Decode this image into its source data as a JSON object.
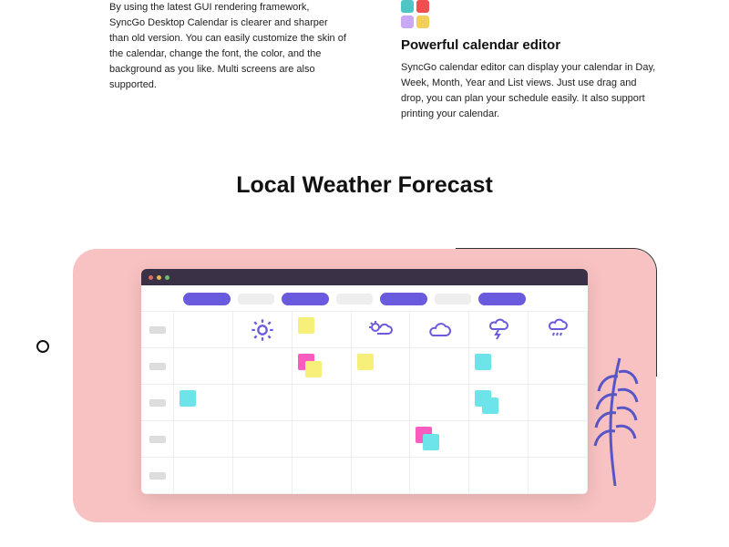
{
  "feature_left": {
    "body": "By using the latest GUI rendering framework, SyncGo Desktop Calendar is clearer and sharper than old version. You can easily customize the skin of the calendar, change the font, the color, and the background as you like. Multi screens are also supported."
  },
  "feature_right": {
    "title": "Powerful calendar editor",
    "body": "SyncGo calendar editor can display your calendar in Day, Week, Month, Year and List views. Just use drag and drop, you can plan your schedule easily.  It also support printing your calendar."
  },
  "section_title": "Local Weather Forecast"
}
